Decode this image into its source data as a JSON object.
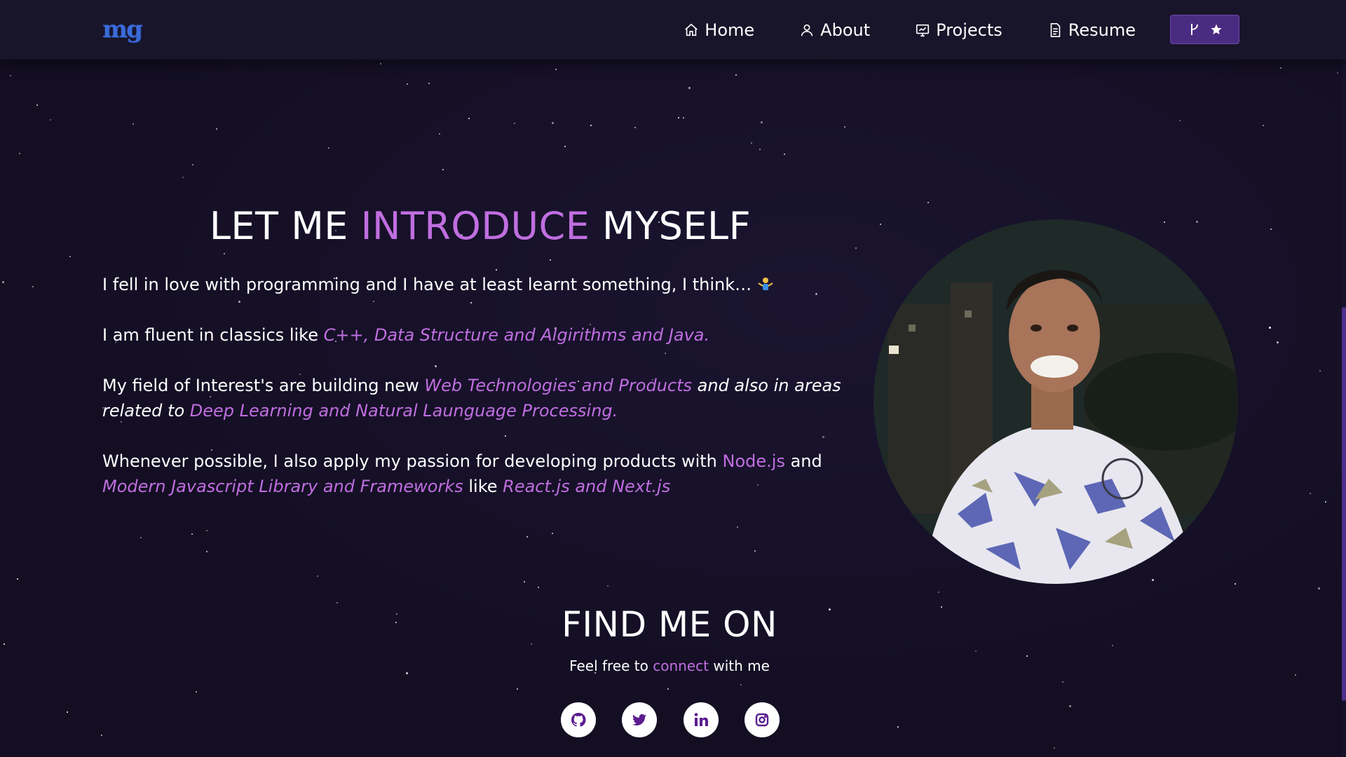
{
  "navbar": {
    "logo": "mg",
    "links": [
      {
        "label": "Home",
        "icon": "home-icon"
      },
      {
        "label": "About",
        "icon": "user-icon"
      },
      {
        "label": "Projects",
        "icon": "projects-icon"
      },
      {
        "label": "Resume",
        "icon": "document-icon"
      }
    ],
    "fork_button_icons": [
      "fork-icon",
      "star-icon"
    ]
  },
  "about": {
    "heading_prefix": "LET ME ",
    "heading_accent": "INTRODUCE",
    "heading_suffix": " MYSELF",
    "p1_text": "I fell in love with programming and I have at least learnt something, I think…",
    "p1_emoji": "person-shrugging-emoji",
    "p2_text": "I am fluent in classics like ",
    "p2_highlight": "C++, Data Structure and Algirithms and Java.",
    "p3_text": "My field of Interest's are building new ",
    "p3_highlight1": "Web Technologies and Products",
    "p3_mid": " and also in areas related to ",
    "p3_highlight2": "Deep Learning and Natural Launguage Processing.",
    "p4_text": "Whenever possible, I also apply my passion for developing products with ",
    "p4_highlight1": "Node.js",
    "p4_mid1": " and ",
    "p4_highlight2": "Modern Javascript Library and Frameworks",
    "p4_mid2": "  like ",
    "p4_highlight3": "React.js and Next.js"
  },
  "avatar": {
    "alt": "profile-photo"
  },
  "social": {
    "title": "FIND ME ON",
    "sub_prefix": "Feel free to ",
    "sub_accent": "connect",
    "sub_suffix": " with me",
    "links": [
      {
        "icon": "github-icon"
      },
      {
        "icon": "twitter-icon"
      },
      {
        "icon": "linkedin-icon"
      },
      {
        "icon": "instagram-icon"
      }
    ]
  },
  "colors": {
    "background": "#140f24",
    "navbar": "#181429",
    "accent": "#c06ee0",
    "fork_button": "#4a2b82",
    "social_icon": "#5b1d8f"
  }
}
